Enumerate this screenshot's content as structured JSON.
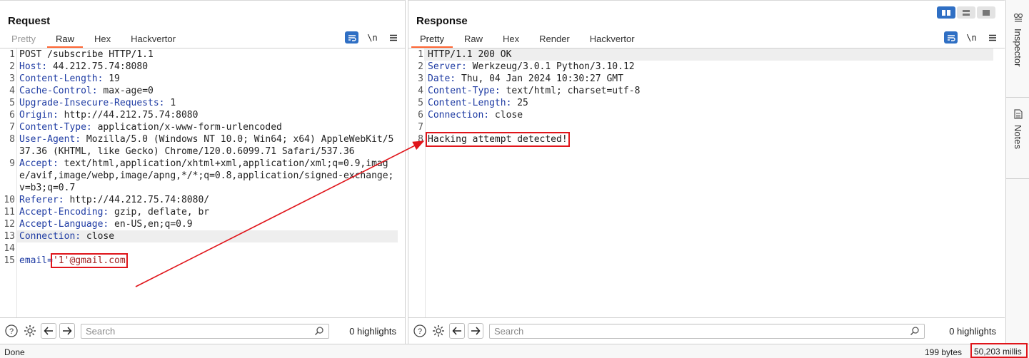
{
  "request": {
    "title": "Request",
    "tabs": [
      "Pretty",
      "Raw",
      "Hex",
      "Hackvertor"
    ],
    "active_tab": "Raw",
    "lines": [
      {
        "n": "1",
        "text": "POST /subscribe HTTP/1.1"
      },
      {
        "n": "2",
        "key": "Host:",
        "value": " 44.212.75.74:8080"
      },
      {
        "n": "3",
        "key": "Content-Length:",
        "value": " 19"
      },
      {
        "n": "4",
        "key": "Cache-Control:",
        "value": " max-age=0"
      },
      {
        "n": "5",
        "key": "Upgrade-Insecure-Requests:",
        "value": " 1"
      },
      {
        "n": "6",
        "key": "Origin:",
        "value": " http://44.212.75.74:8080"
      },
      {
        "n": "7",
        "key": "Content-Type:",
        "value": " application/x-www-form-urlencoded"
      },
      {
        "n": "8",
        "key": "User-Agent:",
        "value": " Mozilla/5.0 (Windows NT 10.0; Win64; x64) AppleWebKit/537.36 (KHTML, like Gecko) Chrome/120.0.6099.71 Safari/537.36"
      },
      {
        "n": "9",
        "key": "Accept:",
        "value": " text/html,application/xhtml+xml,application/xml;q=0.9,image/avif,image/webp,image/apng,*/*;q=0.8,application/signed-exchange;v=b3;q=0.7"
      },
      {
        "n": "10",
        "key": "Referer:",
        "value": " http://44.212.75.74:8080/"
      },
      {
        "n": "11",
        "key": "Accept-Encoding:",
        "value": " gzip, deflate, br"
      },
      {
        "n": "12",
        "key": "Accept-Language:",
        "value": " en-US,en;q=0.9"
      },
      {
        "n": "13",
        "key": "Connection:",
        "value": " close"
      },
      {
        "n": "14",
        "text": ""
      },
      {
        "n": "15",
        "body_key": "email",
        "body_eq": "=",
        "body_value": "'1'@gmail.com"
      }
    ],
    "highlights_label": "0 highlights",
    "search_placeholder": "Search"
  },
  "response": {
    "title": "Response",
    "tabs": [
      "Pretty",
      "Raw",
      "Hex",
      "Render",
      "Hackvertor"
    ],
    "active_tab": "Pretty",
    "lines": [
      {
        "n": "1",
        "text": "HTTP/1.1 200 OK"
      },
      {
        "n": "2",
        "key": "Server:",
        "value": " Werkzeug/3.0.1 Python/3.10.12"
      },
      {
        "n": "3",
        "key": "Date:",
        "value": " Thu, 04 Jan 2024 10:30:27 GMT"
      },
      {
        "n": "4",
        "key": "Content-Type:",
        "value": " text/html; charset=utf-8"
      },
      {
        "n": "5",
        "key": "Content-Length:",
        "value": " 25"
      },
      {
        "n": "6",
        "key": "Connection:",
        "value": " close"
      },
      {
        "n": "7",
        "text": ""
      },
      {
        "n": "8",
        "text": "Hacking attempt detected!"
      }
    ],
    "highlights_label": "0 highlights",
    "search_placeholder": "Search"
  },
  "sidebar": {
    "items": [
      "Inspector",
      "Notes"
    ]
  },
  "status": {
    "left": "Done",
    "bytes": "199 bytes",
    "millis": "50,203 millis"
  },
  "colors": {
    "accent": "#ff6633",
    "header_key": "#1e3ba3",
    "body_value": "#a02020",
    "annotation": "#e0151b",
    "toggle_active": "#2f6fc4"
  },
  "icons": {
    "footer": [
      "help-icon",
      "settings-icon",
      "back-arrow-icon",
      "forward-arrow-icon",
      "magnifier-icon"
    ],
    "toolbar": [
      "wrap-icon",
      "newline-toggle-icon",
      "menu-icon"
    ],
    "sidebar": [
      "inspector-icon",
      "notes-icon"
    ]
  }
}
